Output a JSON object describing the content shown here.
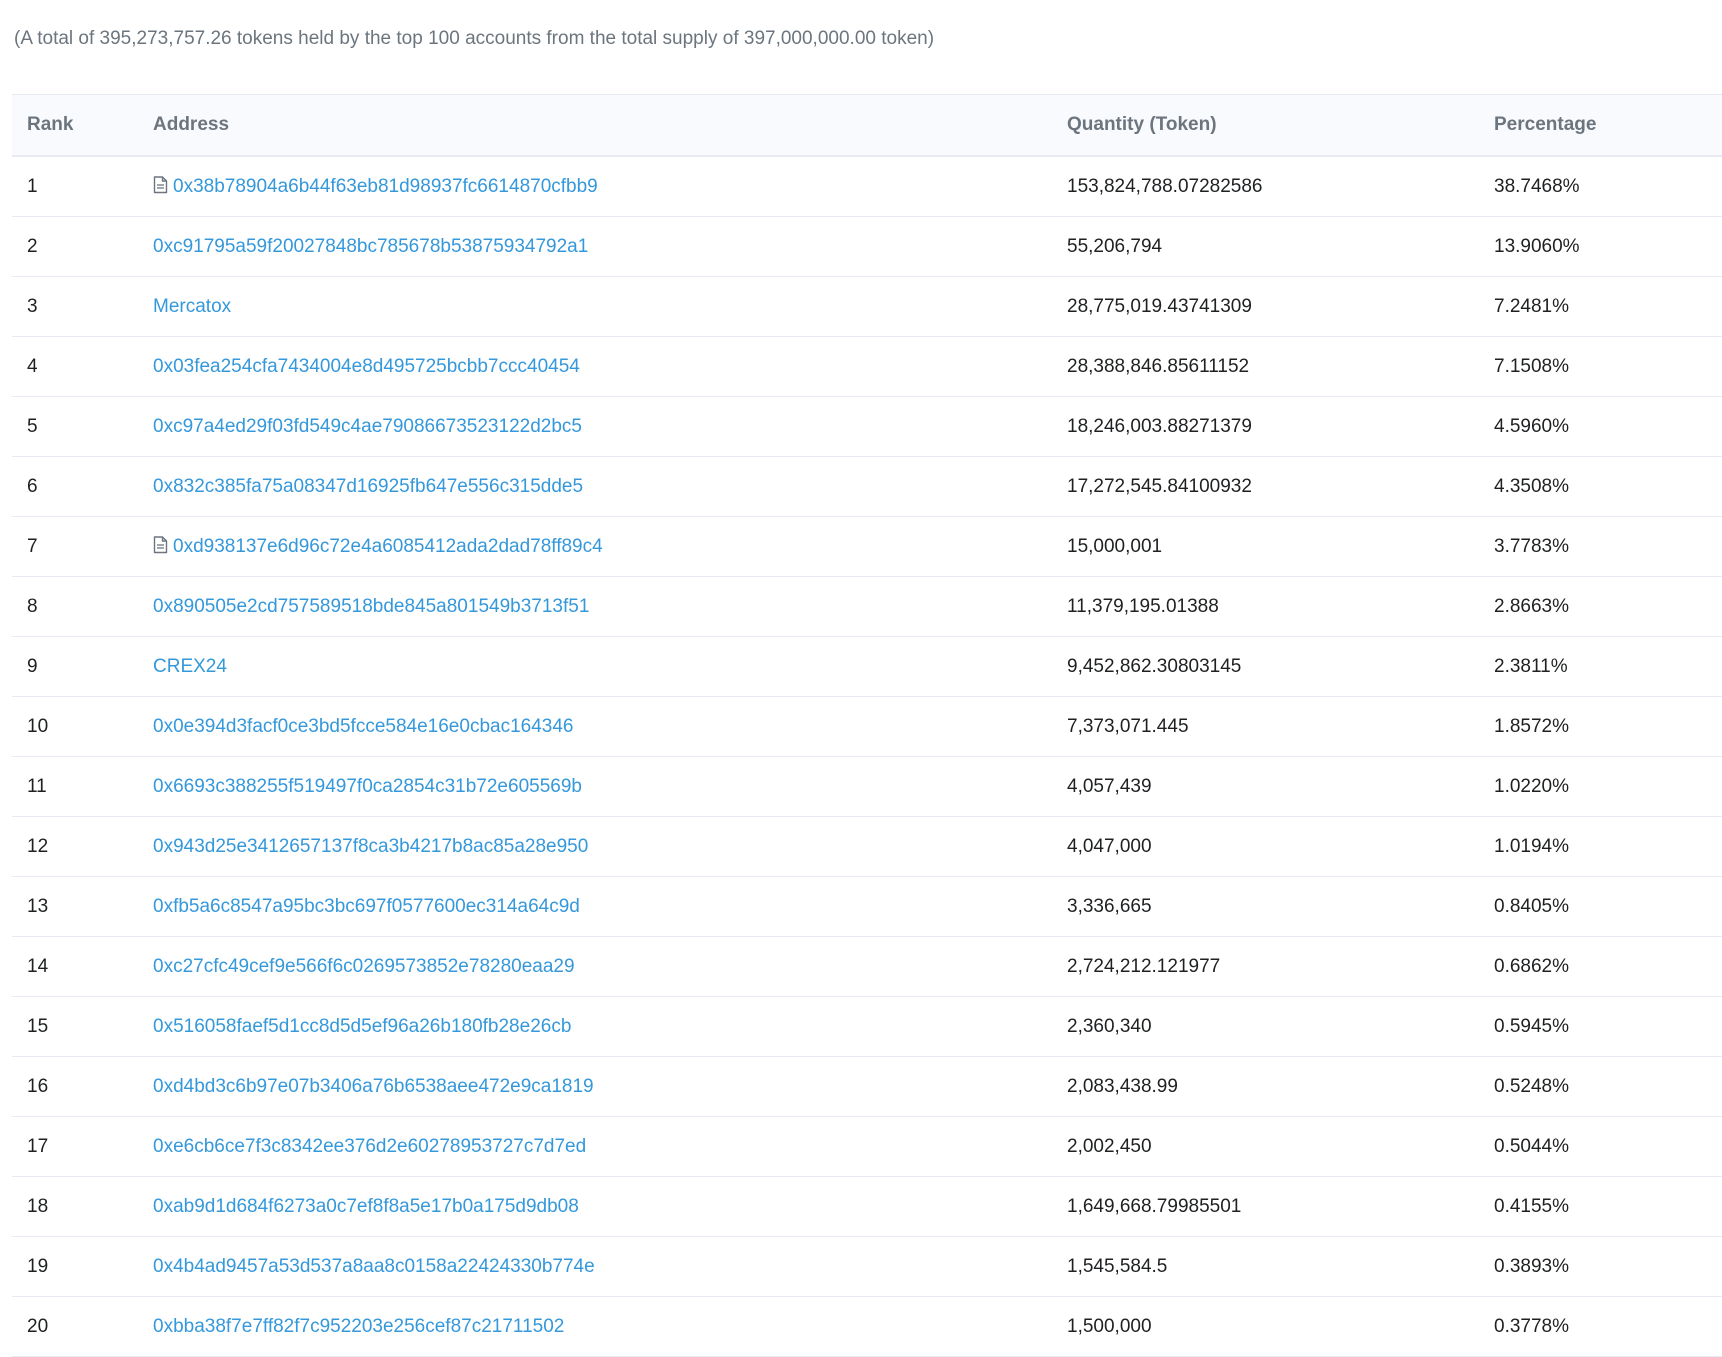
{
  "summary_text": "(A total of 395,273,757.26 tokens held by the top 100 accounts from the total supply of 397,000,000.00 token)",
  "table": {
    "headers": {
      "rank": "Rank",
      "address": "Address",
      "quantity": "Quantity (Token)",
      "percentage": "Percentage"
    },
    "rows": [
      {
        "rank": "1",
        "address": "0x38b78904a6b44f63eb81d98937fc6614870cfbb9",
        "is_contract": true,
        "quantity": "153,824,788.07282586",
        "percentage": "38.7468%"
      },
      {
        "rank": "2",
        "address": "0xc91795a59f20027848bc785678b53875934792a1",
        "is_contract": false,
        "quantity": "55,206,794",
        "percentage": "13.9060%"
      },
      {
        "rank": "3",
        "address": "Mercatox",
        "is_contract": false,
        "quantity": "28,775,019.43741309",
        "percentage": "7.2481%"
      },
      {
        "rank": "4",
        "address": "0x03fea254cfa7434004e8d495725bcbb7ccc40454",
        "is_contract": false,
        "quantity": "28,388,846.85611152",
        "percentage": "7.1508%"
      },
      {
        "rank": "5",
        "address": "0xc97a4ed29f03fd549c4ae79086673523122d2bc5",
        "is_contract": false,
        "quantity": "18,246,003.88271379",
        "percentage": "4.5960%"
      },
      {
        "rank": "6",
        "address": "0x832c385fa75a08347d16925fb647e556c315dde5",
        "is_contract": false,
        "quantity": "17,272,545.84100932",
        "percentage": "4.3508%"
      },
      {
        "rank": "7",
        "address": "0xd938137e6d96c72e4a6085412ada2dad78ff89c4",
        "is_contract": true,
        "quantity": "15,000,001",
        "percentage": "3.7783%"
      },
      {
        "rank": "8",
        "address": "0x890505e2cd757589518bde845a801549b3713f51",
        "is_contract": false,
        "quantity": "11,379,195.01388",
        "percentage": "2.8663%"
      },
      {
        "rank": "9",
        "address": "CREX24",
        "is_contract": false,
        "quantity": "9,452,862.30803145",
        "percentage": "2.3811%"
      },
      {
        "rank": "10",
        "address": "0x0e394d3facf0ce3bd5fcce584e16e0cbac164346",
        "is_contract": false,
        "quantity": "7,373,071.445",
        "percentage": "1.8572%"
      },
      {
        "rank": "11",
        "address": "0x6693c388255f519497f0ca2854c31b72e605569b",
        "is_contract": false,
        "quantity": "4,057,439",
        "percentage": "1.0220%"
      },
      {
        "rank": "12",
        "address": "0x943d25e3412657137f8ca3b4217b8ac85a28e950",
        "is_contract": false,
        "quantity": "4,047,000",
        "percentage": "1.0194%"
      },
      {
        "rank": "13",
        "address": "0xfb5a6c8547a95bc3bc697f0577600ec314a64c9d",
        "is_contract": false,
        "quantity": "3,336,665",
        "percentage": "0.8405%"
      },
      {
        "rank": "14",
        "address": "0xc27cfc49cef9e566f6c0269573852e78280eaa29",
        "is_contract": false,
        "quantity": "2,724,212.121977",
        "percentage": "0.6862%"
      },
      {
        "rank": "15",
        "address": "0x516058faef5d1cc8d5d5ef96a26b180fb28e26cb",
        "is_contract": false,
        "quantity": "2,360,340",
        "percentage": "0.5945%"
      },
      {
        "rank": "16",
        "address": "0xd4bd3c6b97e07b3406a76b6538aee472e9ca1819",
        "is_contract": false,
        "quantity": "2,083,438.99",
        "percentage": "0.5248%"
      },
      {
        "rank": "17",
        "address": "0xe6cb6ce7f3c8342ee376d2e60278953727c7d7ed",
        "is_contract": false,
        "quantity": "2,002,450",
        "percentage": "0.5044%"
      },
      {
        "rank": "18",
        "address": "0xab9d1d684f6273a0c7ef8f8a5e17b0a175d9db08",
        "is_contract": false,
        "quantity": "1,649,668.79985501",
        "percentage": "0.4155%"
      },
      {
        "rank": "19",
        "address": "0x4b4ad9457a53d537a8aa8c0158a22424330b774e",
        "is_contract": false,
        "quantity": "1,545,584.5",
        "percentage": "0.3893%"
      },
      {
        "rank": "20",
        "address": "0xbba38f7e7ff82f7c952203e256cef87c21711502",
        "is_contract": false,
        "quantity": "1,500,000",
        "percentage": "0.3778%"
      }
    ]
  },
  "colors": {
    "link": "#3498db",
    "muted_text": "#6c757e",
    "header_bg": "#f8fafd",
    "border": "#e7eaf3"
  },
  "icons": {
    "contract": "file-contract-icon"
  }
}
